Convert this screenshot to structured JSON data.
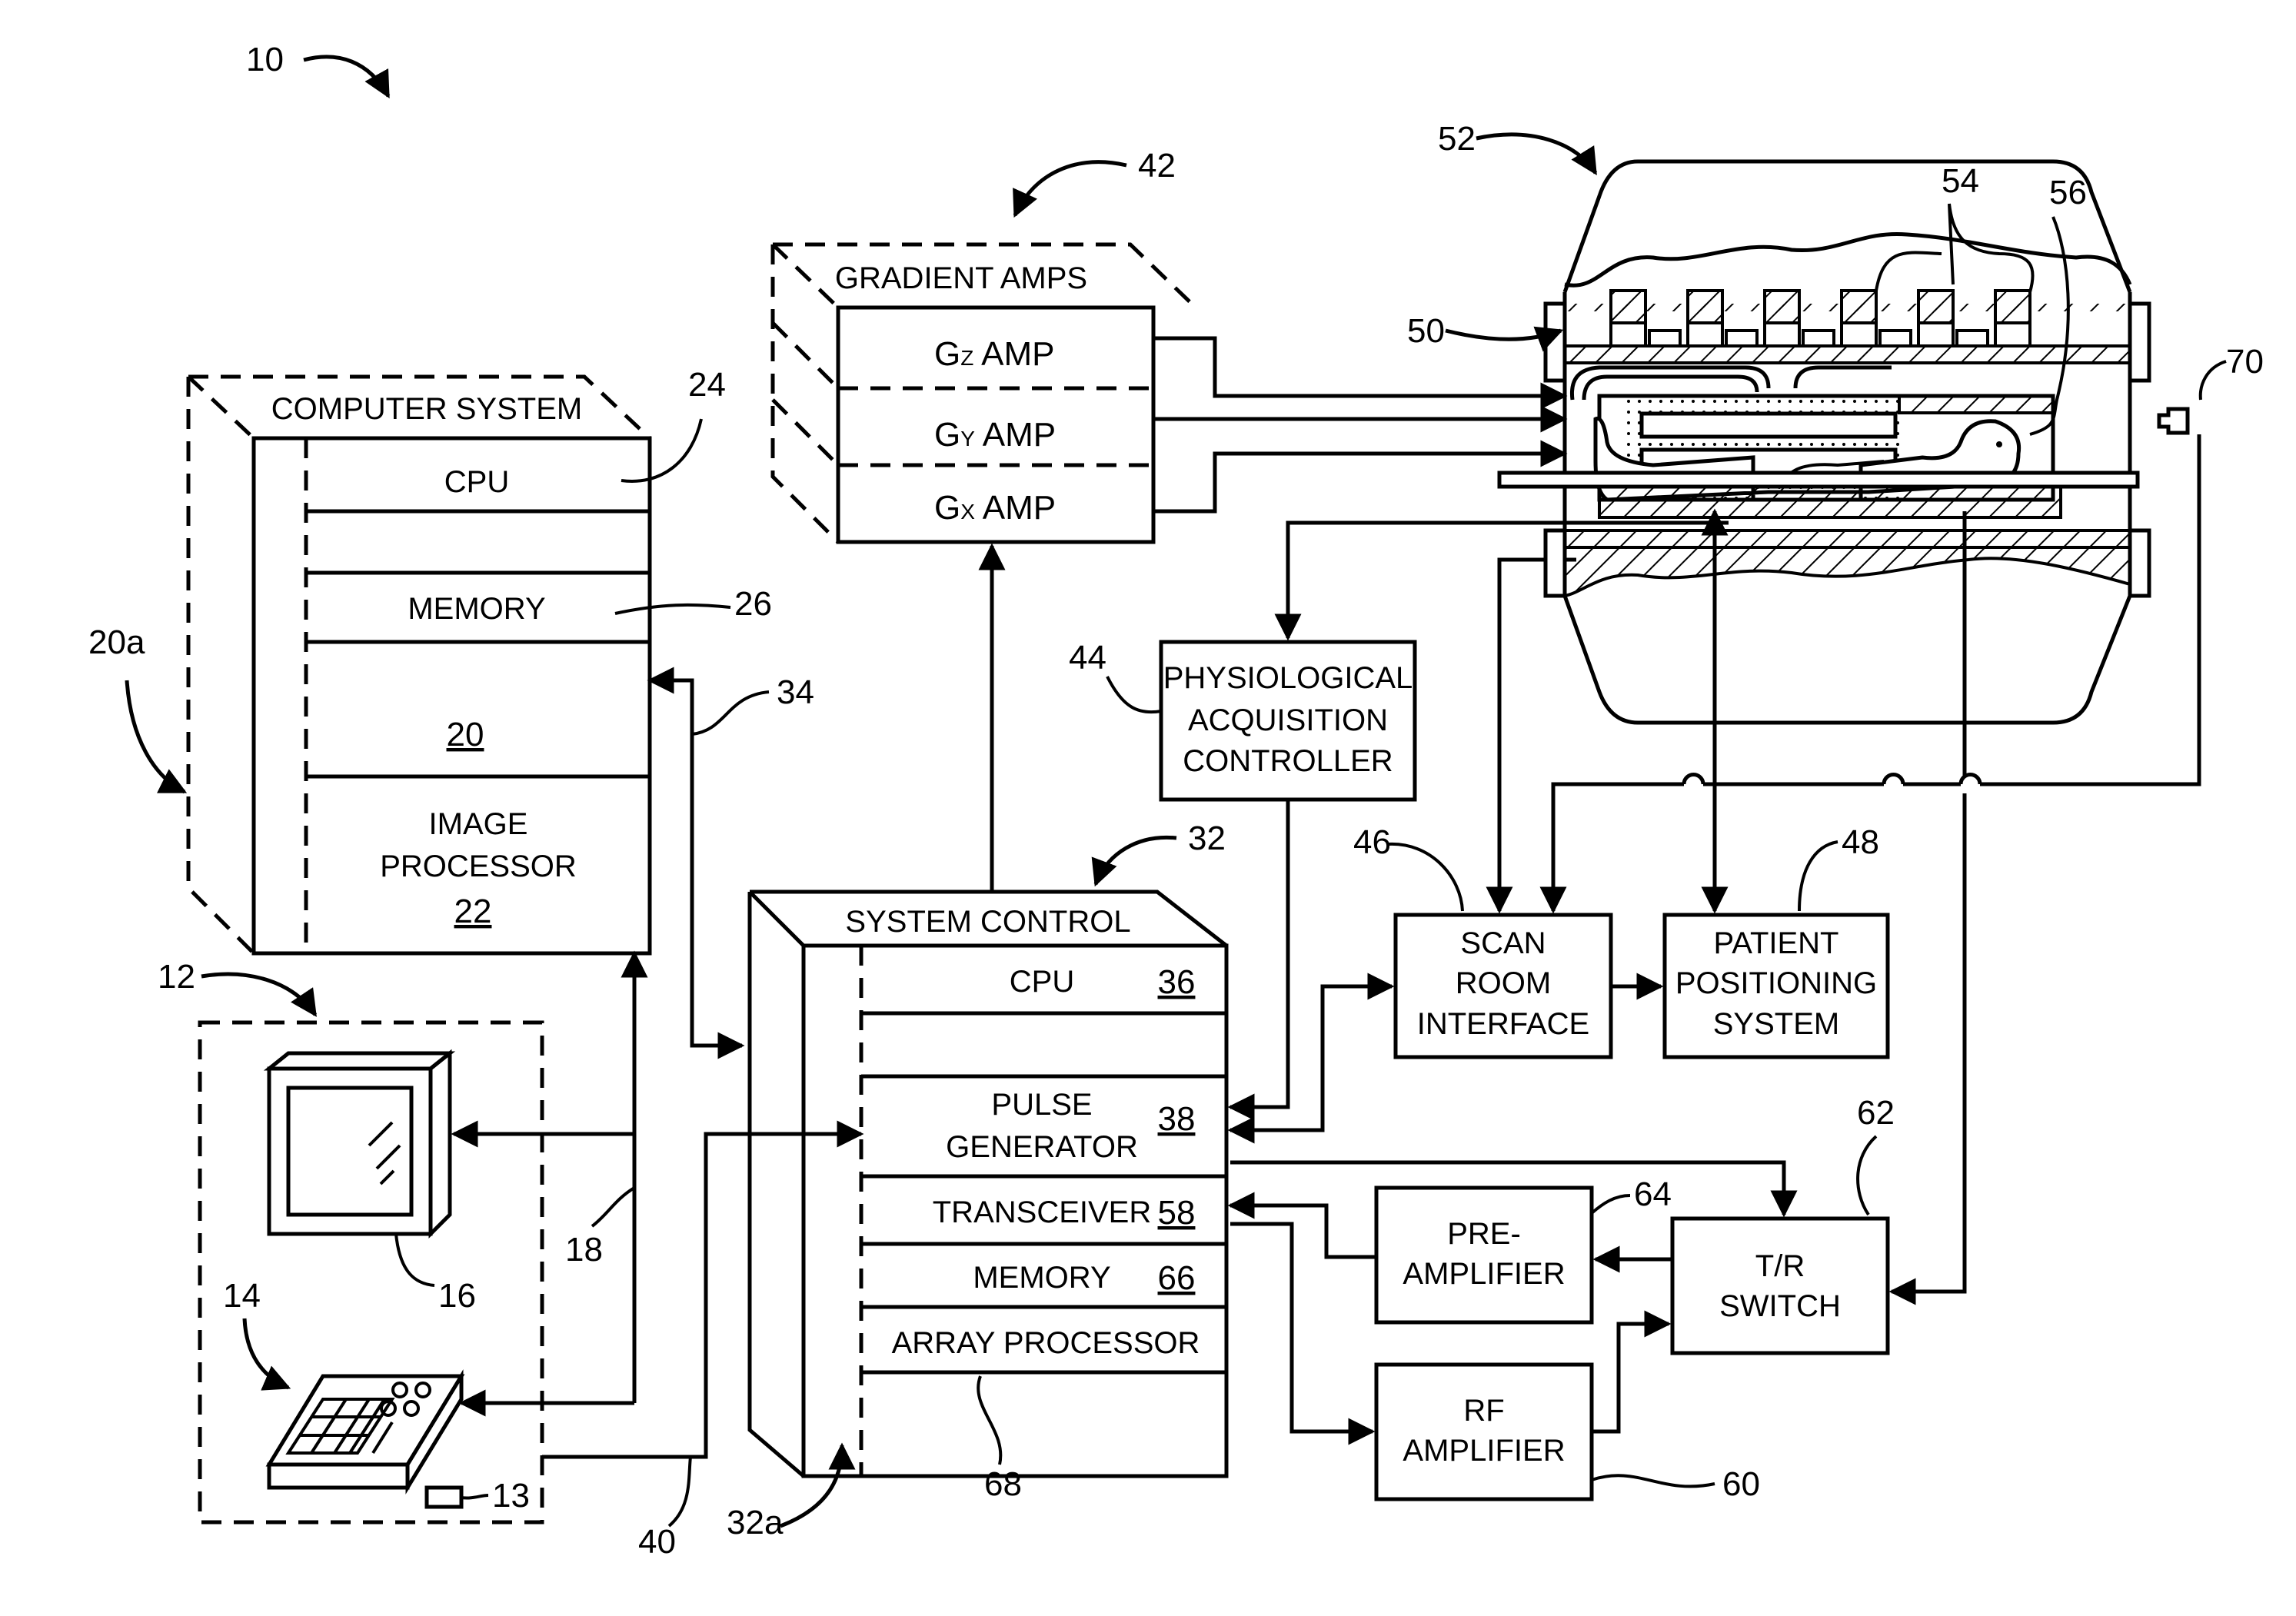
{
  "figure": {
    "system_ref": "10",
    "computer_system": {
      "title": "COMPUTER SYSTEM",
      "ref_outer": "20a",
      "ref_bus": "20",
      "cpu": {
        "label": "CPU",
        "ref": "24"
      },
      "memory": {
        "label": "MEMORY",
        "ref": "26"
      },
      "image_processor": {
        "label_line1": "IMAGE",
        "label_line2": "PROCESSOR",
        "ref": "22"
      }
    },
    "link_refs": {
      "computer_to_control": "34",
      "console_bus": "18",
      "console_to_control": "40"
    },
    "operator_console": {
      "ref": "12",
      "keyboard_ref": "14",
      "display_ref": "16",
      "mouse_ref": "13"
    },
    "gradient_amps": {
      "title": "GRADIENT AMPS",
      "ref": "42",
      "amps": [
        {
          "base": "G",
          "sub": "Z",
          "suffix": " AMP"
        },
        {
          "base": "G",
          "sub": "Y",
          "suffix": " AMP"
        },
        {
          "base": "G",
          "sub": "X",
          "suffix": " AMP"
        }
      ]
    },
    "physiological": {
      "line1": "PHYSIOLOGICAL",
      "line2": "ACQUISITION",
      "line3": "CONTROLLER",
      "ref": "44"
    },
    "system_control": {
      "title": "SYSTEM CONTROL",
      "ref": "32",
      "ref_outer": "32a",
      "cpu": {
        "label": "CPU",
        "ref": "36"
      },
      "pulse_generator": {
        "line1": "PULSE",
        "line2": "GENERATOR",
        "ref": "38"
      },
      "transceiver": {
        "label": "TRANSCEIVER",
        "ref": "58"
      },
      "memory": {
        "label": "MEMORY",
        "ref": "66"
      },
      "array_processor": {
        "label": "ARRAY PROCESSOR",
        "ref": "68"
      }
    },
    "scan_room_interface": {
      "line1": "SCAN",
      "line2": "ROOM",
      "line3": "INTERFACE",
      "ref": "46"
    },
    "patient_positioning": {
      "line1": "PATIENT",
      "line2": "POSITIONING",
      "line3": "SYSTEM",
      "ref": "48"
    },
    "pre_amplifier": {
      "line1": "PRE-",
      "line2": "AMPLIFIER",
      "ref": "64"
    },
    "rf_amplifier": {
      "line1": "RF",
      "line2": "AMPLIFIER",
      "ref": "60"
    },
    "tr_switch": {
      "line1": "T/R",
      "line2": "SWITCH",
      "ref": "62"
    },
    "magnet_assembly": {
      "ref": "52",
      "gradient_coil_ref": "50",
      "rf_coil_ref": "54",
      "patient_ref": "56"
    },
    "camera": {
      "ref": "70"
    }
  }
}
